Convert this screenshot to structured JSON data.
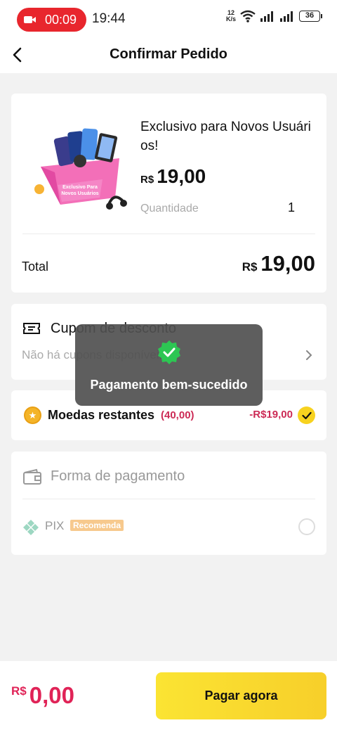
{
  "status_bar": {
    "record_time": "00:09",
    "clock": "19:44",
    "net_speed_value": "12",
    "net_speed_unit": "K/s",
    "battery": "36"
  },
  "header": {
    "title": "Confirmar Pedido"
  },
  "product": {
    "title": "Exclusivo para Novos Usuári os!",
    "price_currency": "R$",
    "price_value": "19,00",
    "quantity_label": "Quantidade",
    "quantity_value": "1",
    "thumb_text": "Exclusivo Para Novos Usuários"
  },
  "total": {
    "label": "Total",
    "currency": "R$",
    "value": "19,00"
  },
  "coupon": {
    "title": "Cupom de desconto",
    "subtitle": "Não há cupons disponíveis"
  },
  "coins": {
    "label": "Moedas restantes",
    "amount": "(40,00)",
    "discount": "-R$19,00"
  },
  "payment": {
    "title": "Forma de pagamento",
    "method": "PIX",
    "badge": "Recomenda"
  },
  "toast": {
    "message": "Pagamento bem-sucedido"
  },
  "bottom": {
    "currency": "R$",
    "value": "0,00",
    "button_label": "Pagar agora"
  },
  "colors": {
    "accent_yellow": "#f7d21f",
    "price_red": "#e02357",
    "coin_red": "#cc2a55",
    "success_green": "#2dc653"
  }
}
